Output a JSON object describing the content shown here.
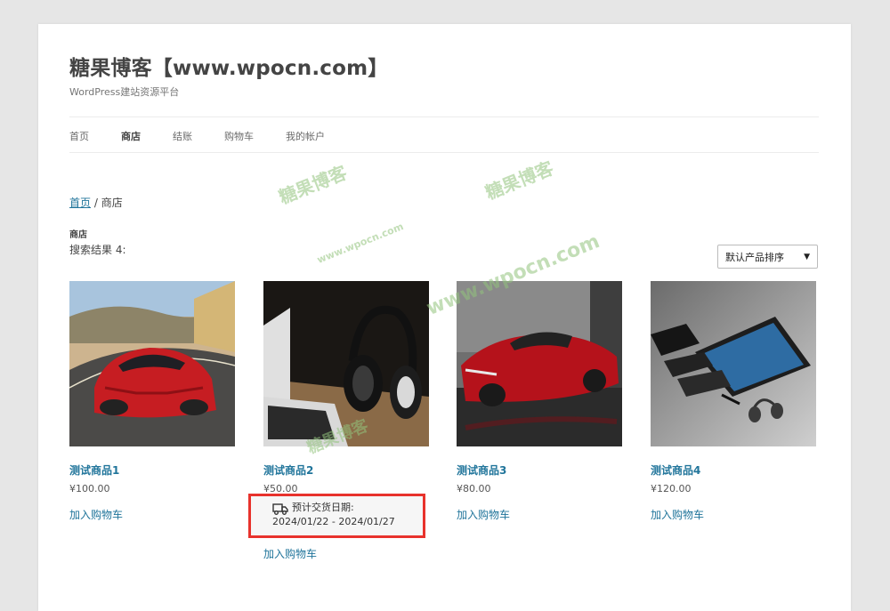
{
  "site": {
    "title": "糖果博客【www.wpocn.com】",
    "tagline": "WordPress建站资源平台"
  },
  "nav": [
    {
      "label": "首页",
      "active": false
    },
    {
      "label": "商店",
      "active": true
    },
    {
      "label": "结账",
      "active": false
    },
    {
      "label": "购物车",
      "active": false
    },
    {
      "label": "我的帐户",
      "active": false
    }
  ],
  "breadcrumb": {
    "home": "首页",
    "separator": " / ",
    "current": "商店"
  },
  "archive_title": "商店",
  "result_count": "搜索结果 4:",
  "orderby": {
    "selected": "默认产品排序"
  },
  "products": [
    {
      "title": "测试商品1",
      "price": "¥100.00",
      "add_to_cart": "加入购物车"
    },
    {
      "title": "测试商品2",
      "price": "¥50.00",
      "add_to_cart": "加入购物车"
    },
    {
      "title": "测试商品3",
      "price": "¥80.00",
      "add_to_cart": "加入购物车"
    },
    {
      "title": "测试商品4",
      "price": "¥120.00",
      "add_to_cart": "加入购物车"
    }
  ],
  "delivery": {
    "label": "预计交货日期:",
    "range": "2024/01/22 - 2024/01/27",
    "highlight_color": "#e8322c"
  },
  "watermarks": {
    "brand": "糖果博客",
    "url": "www.wpocn.com"
  },
  "colors": {
    "link": "#21759b",
    "text": "#444444",
    "background": "#e6e6e6"
  }
}
